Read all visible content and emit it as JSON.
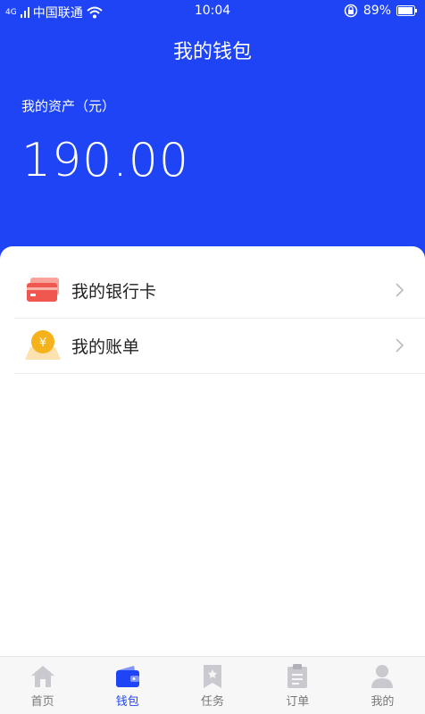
{
  "status_bar": {
    "carrier": "中国联通",
    "network": "4G",
    "time": "10:04",
    "battery": "89%"
  },
  "header": {
    "title": "我的钱包",
    "asset_label": "我的资产（元）",
    "asset_value": "190.00"
  },
  "menu": {
    "items": [
      {
        "label": "我的银行卡",
        "icon": "bank-card-icon"
      },
      {
        "label": "我的账单",
        "icon": "bill-coin-icon"
      }
    ]
  },
  "tabbar": {
    "items": [
      {
        "label": "首页",
        "icon": "home-icon"
      },
      {
        "label": "钱包",
        "icon": "wallet-icon",
        "active": true
      },
      {
        "label": "任务",
        "icon": "task-bookmark-icon"
      },
      {
        "label": "订单",
        "icon": "order-clipboard-icon"
      },
      {
        "label": "我的",
        "icon": "profile-icon"
      }
    ]
  },
  "colors": {
    "brand_blue": "#1e44f5",
    "card_red": "#f0584f",
    "coin_yellow": "#f6b21b"
  }
}
